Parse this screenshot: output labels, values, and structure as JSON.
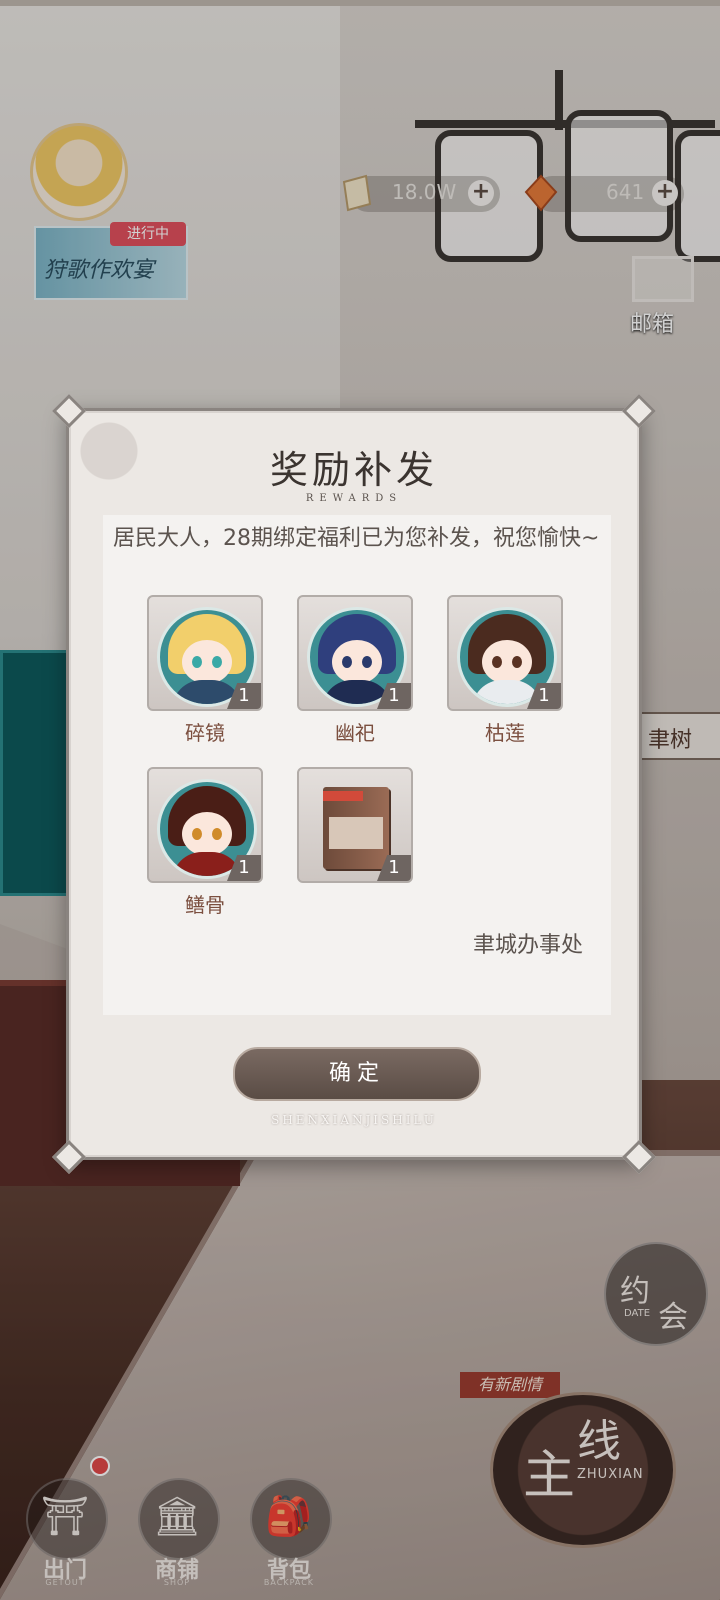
{
  "hud": {
    "event": {
      "badge": "进行中",
      "title": "狩歌作欢宴"
    },
    "currency1": {
      "value": "18.0W",
      "icon": "gem-note-icon"
    },
    "currency2": {
      "value": "641",
      "icon": "crystal-icon"
    },
    "mail_label": "邮箱",
    "tree_label": "聿树"
  },
  "dialog": {
    "title": "奖励补发",
    "subtitle": "REWARDS",
    "message": "居民大人，28期绑定福利已为您补发，祝您愉快~",
    "sender": "聿城办事处",
    "confirm_label": "确定",
    "brand": "SHENXIANJISHILU",
    "items": [
      {
        "name": "碎镜",
        "count": "1",
        "hair": "#f2cf6b",
        "eye": "#3aa9a6",
        "body": "#2d4b6b"
      },
      {
        "name": "幽祀",
        "count": "1",
        "hair": "#2f3f7d",
        "eye": "#2a3a6c",
        "body": "#1f2c52"
      },
      {
        "name": "枯莲",
        "count": "1",
        "hair": "#4b2b1f",
        "eye": "#5a3222",
        "body": "#e9ecef"
      },
      {
        "name": "鳝骨",
        "count": "1",
        "hair": "#4a1e16",
        "eye": "#d08b2a",
        "body": "#8a1f1b"
      },
      {
        "name": "",
        "count": "1",
        "kind": "book"
      }
    ]
  },
  "nav": {
    "items": [
      {
        "cn": "出门",
        "en": "GETOUT",
        "glyph": "⛩"
      },
      {
        "cn": "商铺",
        "en": "SHOP",
        "glyph": "🏛"
      },
      {
        "cn": "背包",
        "en": "BACKPACK",
        "glyph": "🎒"
      }
    ],
    "date": {
      "cn1": "约",
      "cn2": "会",
      "en": "DATE"
    },
    "story": {
      "badge": "有新剧情",
      "c1": "主",
      "c2": "线",
      "en": "ZHUXIAN"
    }
  }
}
